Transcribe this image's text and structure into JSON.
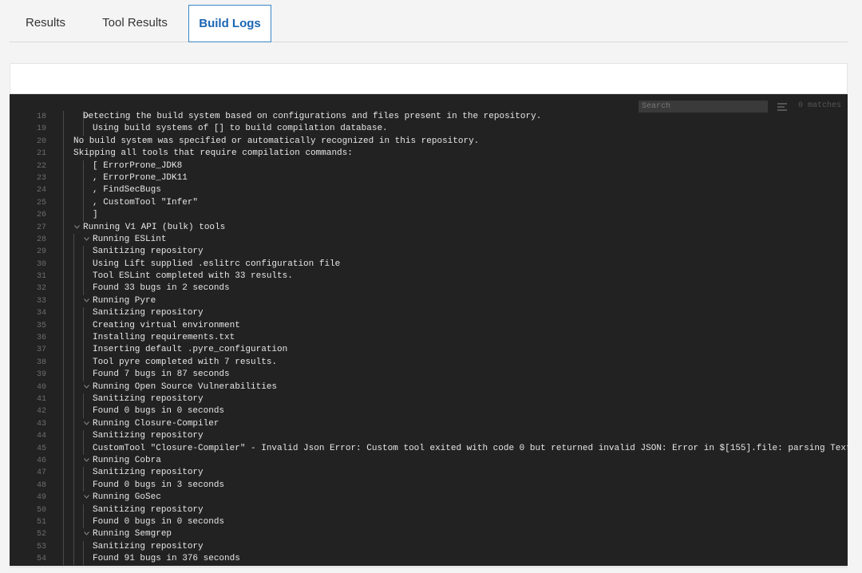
{
  "tabs": [
    {
      "label": "Results"
    },
    {
      "label": "Tool Results"
    },
    {
      "label": "Build Logs"
    }
  ],
  "log_search": {
    "placeholder": "Search",
    "matches": "0 matches"
  },
  "log_lines": [
    {
      "num": "18",
      "text": "Detecting the build system based on configurations and files present in the repository."
    },
    {
      "num": "19",
      "text": "Using build systems of [] to build compilation database."
    },
    {
      "num": "20",
      "text": "No build system was specified or automatically recognized in this repository."
    },
    {
      "num": "21",
      "text": "Skipping all tools that require compilation commands:"
    },
    {
      "num": "22",
      "text": "[ ErrorProne_JDK8"
    },
    {
      "num": "23",
      "text": ", ErrorProne_JDK11"
    },
    {
      "num": "24",
      "text": ", FindSecBugs"
    },
    {
      "num": "25",
      "text": ", CustomTool \"Infer\""
    },
    {
      "num": "26",
      "text": "]"
    },
    {
      "num": "27",
      "text": "Running V1 API (bulk) tools"
    },
    {
      "num": "28",
      "text": "Running ESLint"
    },
    {
      "num": "29",
      "text": "Sanitizing repository"
    },
    {
      "num": "30",
      "text": "Using Lift supplied .eslitrc configuration file"
    },
    {
      "num": "31",
      "text": "Tool ESLint completed with 33 results."
    },
    {
      "num": "32",
      "text": "Found 33 bugs in 2 seconds"
    },
    {
      "num": "33",
      "text": "Running Pyre"
    },
    {
      "num": "34",
      "text": "Sanitizing repository"
    },
    {
      "num": "35",
      "text": "Creating virtual environment"
    },
    {
      "num": "36",
      "text": "Installing requirements.txt"
    },
    {
      "num": "37",
      "text": "Inserting default .pyre_configuration"
    },
    {
      "num": "38",
      "text": "Tool pyre completed with 7 results."
    },
    {
      "num": "39",
      "text": "Found 7 bugs in 87 seconds"
    },
    {
      "num": "40",
      "text": "Running Open Source Vulnerabilities"
    },
    {
      "num": "41",
      "text": "Sanitizing repository"
    },
    {
      "num": "42",
      "text": "Found 0 bugs in 0 seconds"
    },
    {
      "num": "43",
      "text": "Running Closure-Compiler"
    },
    {
      "num": "44",
      "text": "Sanitizing repository"
    },
    {
      "num": "45",
      "text": "CustomTool \"Closure-Compiler\" - Invalid Json Error: Custom tool exited with code 0 but returned invalid JSON: Error in $[155].file: parsing Text failed"
    },
    {
      "num": "46",
      "text": "Running Cobra"
    },
    {
      "num": "47",
      "text": "Sanitizing repository"
    },
    {
      "num": "48",
      "text": "Found 0 bugs in 3 seconds"
    },
    {
      "num": "49",
      "text": "Running GoSec"
    },
    {
      "num": "50",
      "text": "Sanitizing repository"
    },
    {
      "num": "51",
      "text": "Found 0 bugs in 0 seconds"
    },
    {
      "num": "52",
      "text": "Running Semgrep"
    },
    {
      "num": "53",
      "text": "Sanitizing repository"
    },
    {
      "num": "54",
      "text": "Found 91 bugs in 376 seconds"
    }
  ]
}
